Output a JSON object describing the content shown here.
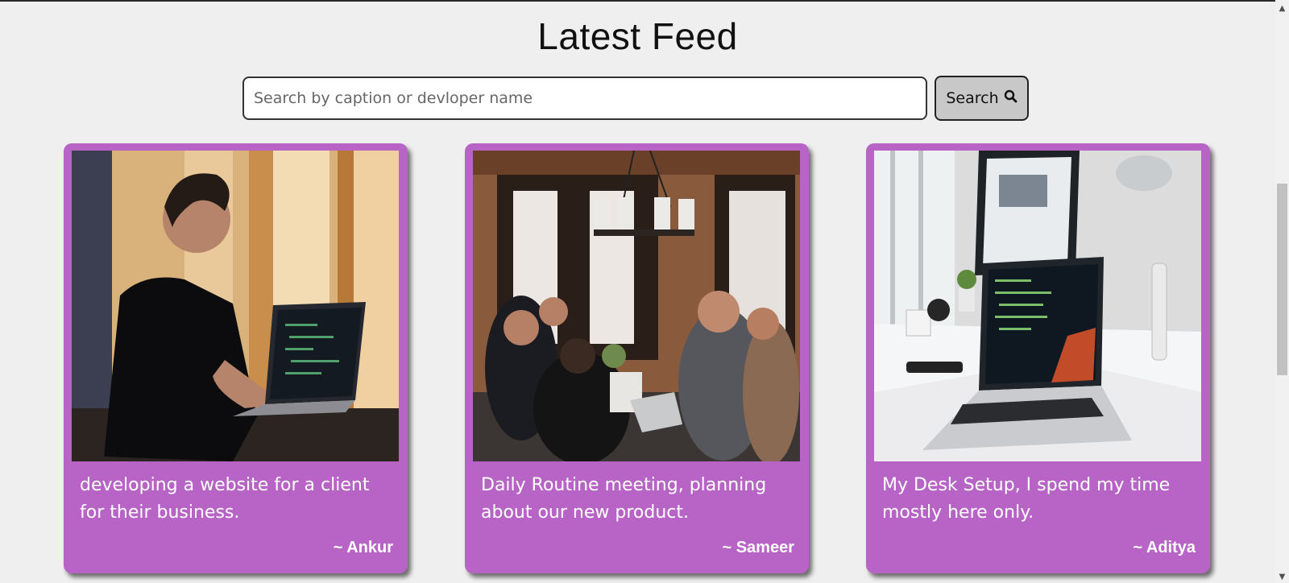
{
  "header": {
    "title": "Latest Feed"
  },
  "search": {
    "placeholder": "Search by caption or devloper name",
    "value": "",
    "button_label": "Search"
  },
  "posts": [
    {
      "caption": "developing a website for a client for their business.",
      "author": "~ Ankur"
    },
    {
      "caption": "Daily Routine meeting, planning about our new product.",
      "author": "~ Sameer"
    },
    {
      "caption": "My Desk Setup, I spend my time mostly here only.",
      "author": "~ Aditya"
    }
  ],
  "colors": {
    "card": "#b764c6",
    "background": "#efefef",
    "button": "#c8c8c8"
  },
  "icons": {
    "search_button": "search-icon"
  }
}
